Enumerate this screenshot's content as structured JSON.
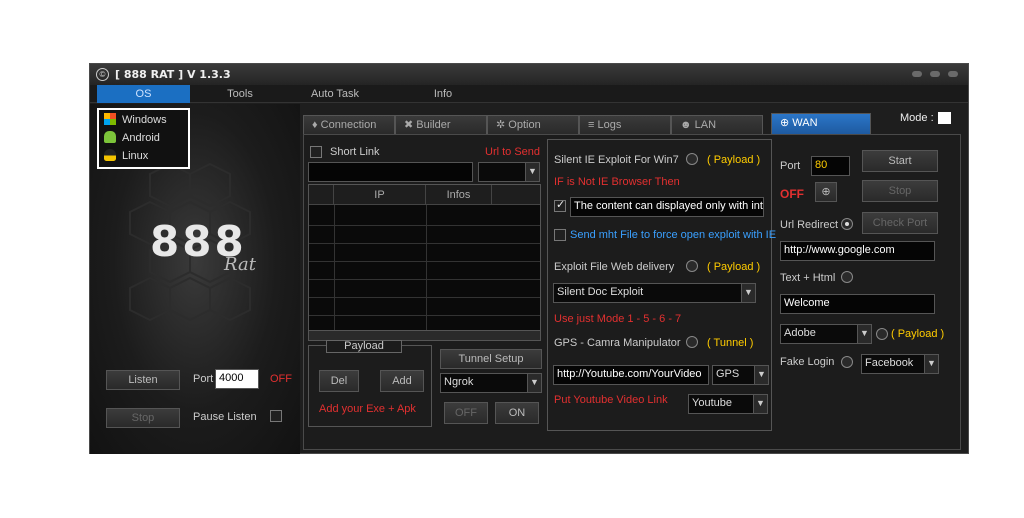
{
  "window": {
    "title": "[ 888 RAT ] V 1.3.3",
    "app_icon": "©"
  },
  "menu": [
    "OS",
    "Tools",
    "Auto Task",
    "Info"
  ],
  "os_dropdown": [
    "Windows",
    "Android",
    "Linux"
  ],
  "logo": {
    "main": "888",
    "sub": "Rat"
  },
  "left": {
    "listen": "Listen",
    "stop": "Stop",
    "port_label": "Port",
    "port_value": "4000",
    "status": "OFF",
    "pause_label": "Pause Listen"
  },
  "tabs": [
    "Connection",
    "Builder",
    "Option",
    "Logs",
    "LAN",
    "WAN"
  ],
  "mode_label": "Mode :",
  "connection": {
    "short_link": "Short Link",
    "url_to_send": "Url to Send",
    "grid_headers": [
      "IP",
      "Infos"
    ],
    "payload_label": "Payload",
    "del": "Del",
    "add": "Add",
    "add_exe": "Add your Exe + Apk",
    "tunnel_setup": "Tunnel Setup",
    "tunnel_value": "Ngrok",
    "off": "OFF",
    "on": "ON"
  },
  "exploits": {
    "silent_ie": "Silent IE Exploit For Win7",
    "payload1": "( Payload )",
    "not_ie": "IF is Not IE Browser Then",
    "display_text": "The content can displayed only with interr",
    "send_mht": "Send mht File to force open exploit with IE",
    "exploit_file": "Exploit File Web delivery",
    "payload2": "( Payload )",
    "silent_doc": "Silent Doc Exploit",
    "use_mode": "Use just Mode 1 - 5 - 6 - 7",
    "gps_label": "GPS - Camra Manipulator",
    "tunnel": "( Tunnel )",
    "youtube_url": "http://Youtube.com/YourVideo",
    "gps": "GPS",
    "put_youtube": "Put Youtube Video Link",
    "youtube": "Youtube"
  },
  "wan": {
    "port_label": "Port",
    "port_value": "80",
    "start": "Start",
    "off": "OFF",
    "stop": "Stop",
    "url_redirect": "Url Redirect",
    "check_port": "Check Port",
    "url_value": "http://www.google.com",
    "text_html": "Text + Html",
    "welcome": "Welcome",
    "adobe": "Adobe",
    "payload": "( Payload )",
    "fake_login": "Fake Login",
    "facebook": "Facebook"
  }
}
